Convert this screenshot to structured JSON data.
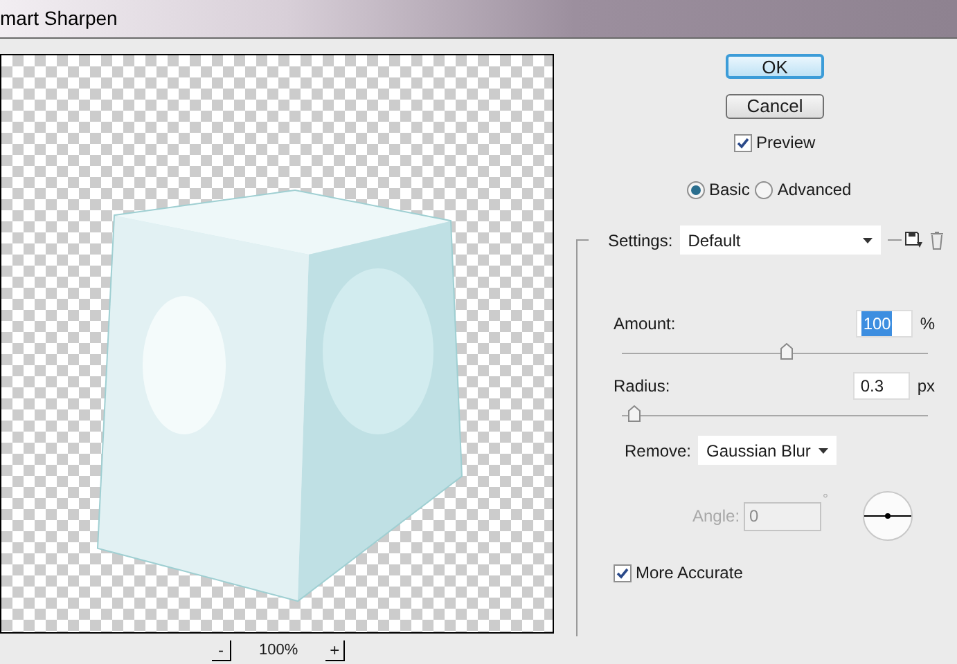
{
  "window": {
    "title": "mart Sharpen"
  },
  "preview": {
    "zoom_out": "-",
    "zoom_level": "100%",
    "zoom_in": "+"
  },
  "buttons": [
    {
      "label": "OK",
      "default": true
    },
    {
      "label": "Cancel",
      "default": false
    }
  ],
  "preview_checkbox": {
    "label": "Preview",
    "checked": true
  },
  "mode": [
    {
      "label": "Basic",
      "selected": true
    },
    {
      "label": "Advanced",
      "selected": false
    }
  ],
  "settings": {
    "label": "Settings:",
    "value": "Default"
  },
  "amount": {
    "label": "Amount:",
    "value": "100",
    "unit": "%",
    "level": 0.54,
    "focused": true
  },
  "radius": {
    "label": "Radius:",
    "value": "0.3",
    "unit": "px",
    "level": 0.04,
    "focused": false
  },
  "remove": {
    "label": "Remove:",
    "value": "Gaussian Blur"
  },
  "angle": {
    "label": "Angle:",
    "value": "0",
    "unit": "°",
    "disabled": true
  },
  "more_accurate": {
    "label": "More Accurate",
    "checked": true
  }
}
